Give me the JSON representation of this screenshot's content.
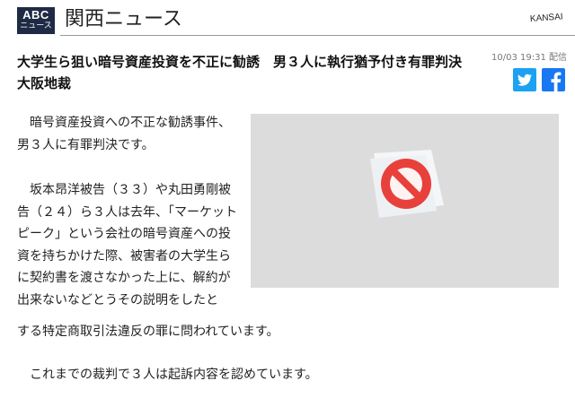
{
  "header": {
    "logo_line1": "ABC",
    "logo_line2": "ニュース",
    "site_name": "関西ニュース",
    "region": "KANSAI"
  },
  "article": {
    "title": "大学生ら狙い暗号資産投資を不正に勧誘　男３人に執行猶予付き有罪判決　大阪地裁",
    "timestamp": "10/03 19:31 配信",
    "paragraph1": "　暗号資産投資への不正な勧誘事件、男３人に有罪判決です。",
    "paragraph2_wrapped": "　坂本昂洋被告（３３）や丸田勇剛被告（２４）ら３人は去年、「マーケットピーク」という会社の暗号資産への投資を持ちかけた際、被害者の大学生らに契約書を渡さなかった上に、解約が出来ないなどとうその説明をしたと",
    "paragraph2_tail": "する特定商取引法違反の罪に問われています。",
    "paragraph3": "　これまでの裁判で３人は起訴内容を認めています。"
  },
  "social": {
    "twitter_icon": "twitter-icon",
    "facebook_icon": "facebook-icon"
  },
  "media": {
    "icon": "image-unavailable-icon",
    "colors": {
      "placeholder_bg": "#dcdcdc",
      "prohibited_red": "#e8413b"
    }
  },
  "colors": {
    "logo_bg": "#1f2a44",
    "twitter": "#1da1f2",
    "facebook": "#1877f2"
  }
}
